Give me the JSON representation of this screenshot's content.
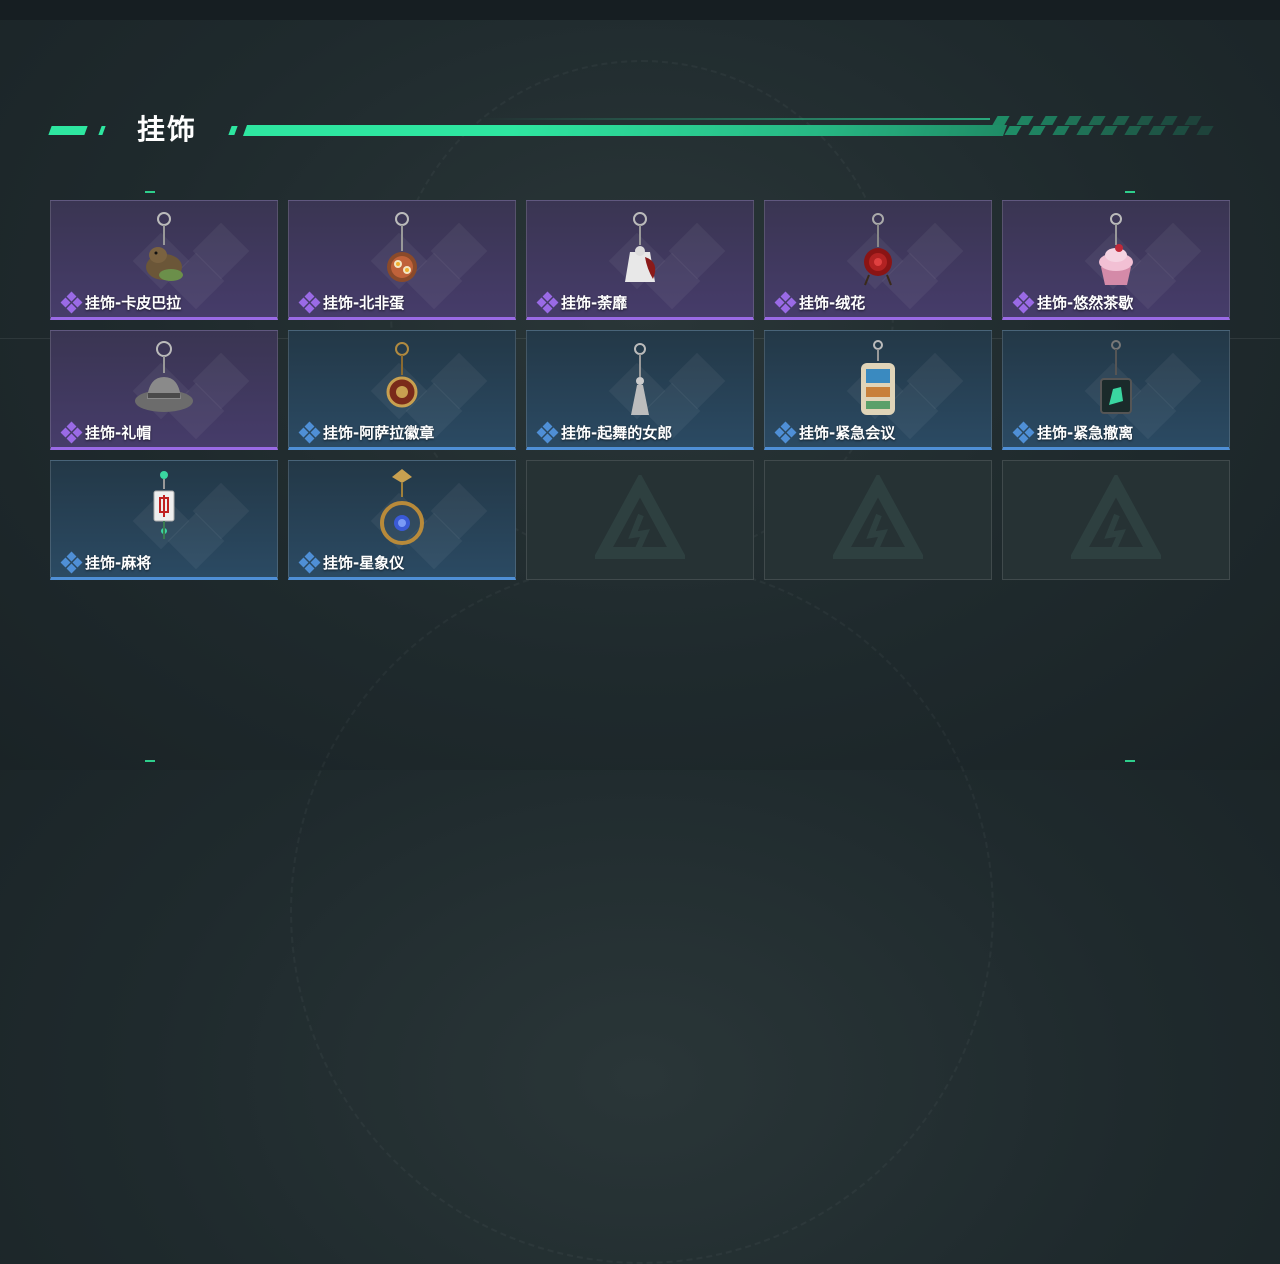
{
  "section": {
    "title": "挂饰"
  },
  "colors": {
    "accent": "#2ee6a0",
    "rarity_purple": "#9a6ae6",
    "rarity_blue": "#4f8fd6"
  },
  "items": [
    {
      "label": "挂饰-卡皮巴拉",
      "rarity": "purple",
      "icon": "capybara-charm-icon"
    },
    {
      "label": "挂饰-北非蛋",
      "rarity": "purple",
      "icon": "shakshuka-charm-icon"
    },
    {
      "label": "挂饰-荼靡",
      "rarity": "purple",
      "icon": "flower-figure-charm-icon"
    },
    {
      "label": "挂饰-绒花",
      "rarity": "purple",
      "icon": "red-flower-charm-icon"
    },
    {
      "label": "挂饰-悠然茶歇",
      "rarity": "purple",
      "icon": "cupcake-charm-icon"
    },
    {
      "label": "挂饰-礼帽",
      "rarity": "purple",
      "icon": "hat-charm-icon"
    },
    {
      "label": "挂饰-阿萨拉徽章",
      "rarity": "blue",
      "icon": "badge-charm-icon"
    },
    {
      "label": "挂饰-起舞的女郎",
      "rarity": "blue",
      "icon": "dancer-charm-icon"
    },
    {
      "label": "挂饰-紧急会议",
      "rarity": "blue",
      "icon": "meeting-charm-icon"
    },
    {
      "label": "挂饰-紧急撤离",
      "rarity": "blue",
      "icon": "evacuation-charm-icon"
    },
    {
      "label": "挂饰-麻将",
      "rarity": "blue",
      "icon": "mahjong-charm-icon"
    },
    {
      "label": "挂饰-星象仪",
      "rarity": "blue",
      "icon": "astrolabe-charm-icon"
    },
    {
      "label": "",
      "rarity": "empty",
      "icon": "empty-slot-logo-icon"
    },
    {
      "label": "",
      "rarity": "empty",
      "icon": "empty-slot-logo-icon"
    },
    {
      "label": "",
      "rarity": "empty",
      "icon": "empty-slot-logo-icon"
    }
  ]
}
